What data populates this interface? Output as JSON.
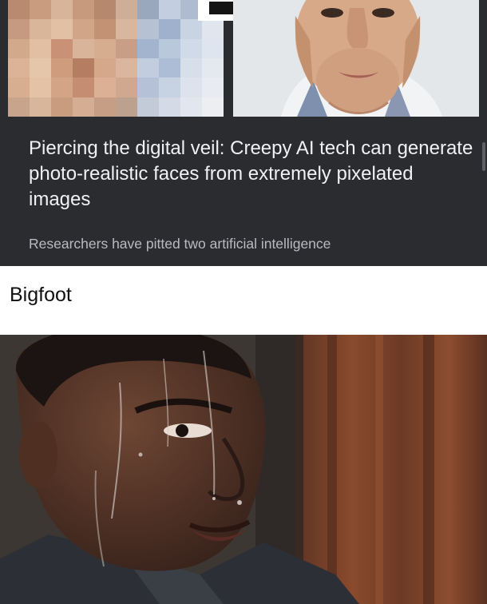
{
  "article": {
    "headline": "Piercing the digital veil: Creepy AI tech can generate photo-realistic faces from extremely pixelated images",
    "summary": "Researchers have pitted two artificial intelligence"
  },
  "caption": {
    "text": "Bigfoot"
  },
  "colors": {
    "card_bg": "#2b2c30",
    "headline": "#f1f1f3",
    "summary": "#b9bbc0",
    "caption_bg": "#ffffff"
  }
}
